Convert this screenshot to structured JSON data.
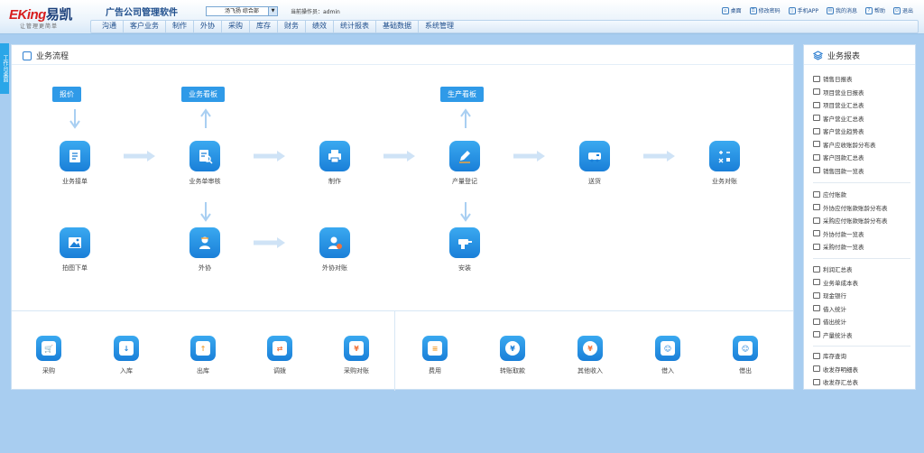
{
  "header": {
    "logo_brand": "EKing",
    "logo_cn": "易凯",
    "logo_slogan": "让管理更简单",
    "app_title": "广告公司管理软件",
    "user_select_value": "汤飞扬 综合部",
    "current_operator": "当前操作员：admin",
    "top_links": [
      {
        "label": "桌面",
        "icon": "home-icon"
      },
      {
        "label": "修改密码",
        "icon": "key-icon"
      },
      {
        "label": "手机APP",
        "icon": "phone-icon"
      },
      {
        "label": "我的消息",
        "icon": "message-icon"
      },
      {
        "label": "帮助",
        "icon": "help-icon"
      },
      {
        "label": "退出",
        "icon": "power-icon"
      }
    ]
  },
  "nav": [
    "沟通",
    "客户业务",
    "制作",
    "外协",
    "采购",
    "库存",
    "财务",
    "绩效",
    "统计报表",
    "基础数据",
    "系统管理"
  ],
  "side_tab": "工作台桌面",
  "flow_panel": {
    "title": "业务流程",
    "tags": {
      "quote": "报价",
      "business_board": "业务看板",
      "production_board": "生产看板"
    },
    "nodes": {
      "business_order": "业务接单",
      "order_review": "业务单审核",
      "production": "制作",
      "production_register": "产量登记",
      "delivery": "送货",
      "reconcile": "业务对账",
      "picture_order": "拍图下单",
      "outsource": "外协",
      "outsource_reconcile": "外协对账",
      "install": "安装"
    },
    "tools_left": [
      "采购",
      "入库",
      "出库",
      "调拨",
      "采购对账"
    ],
    "tools_right": [
      "费用",
      "转账取款",
      "其他收入",
      "借入",
      "借出"
    ]
  },
  "reports_panel": {
    "title": "业务报表",
    "group1": [
      "销售日报表",
      "项目营业日报表",
      "项目营业汇总表",
      "客户营业汇总表",
      "客户营业趋势表",
      "客户应收账龄分布表",
      "客户回款汇总表",
      "销售回款一览表"
    ],
    "group2": [
      "应付账款",
      "外协应付账款账龄分布表",
      "采购应付账款账龄分布表",
      "外协付款一览表",
      "采购付款一览表"
    ],
    "group3": [
      "利润汇总表",
      "业务单成本表",
      "现金银行",
      "借入统计",
      "借出统计",
      "产量统计表"
    ],
    "group4": [
      "库存查询",
      "收发存明细表",
      "收发存汇总表"
    ]
  },
  "colors": {
    "accent": "#2f9ae8",
    "icon_gradient_top": "#3aa9f0",
    "icon_gradient_bottom": "#1a7fd8",
    "background": "#a8cdf0"
  }
}
